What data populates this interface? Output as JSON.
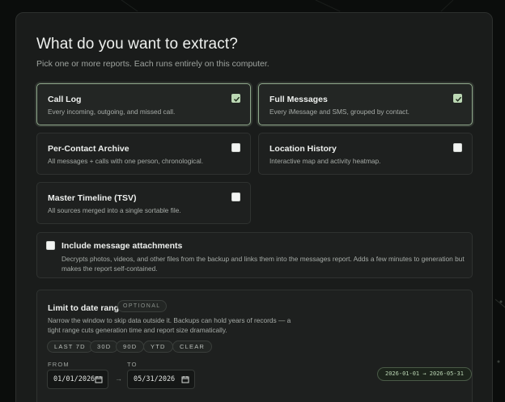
{
  "heading": "What do you want to extract?",
  "subheading": "Pick one or more reports. Each runs entirely on this computer.",
  "reports": [
    {
      "title": "Call Log",
      "description": "Every incoming, outgoing, and missed call.",
      "checked": true
    },
    {
      "title": "Full Messages",
      "description": "Every iMessage and SMS, grouped by contact.",
      "checked": true
    },
    {
      "title": "Per-Contact Archive",
      "description": "All messages + calls with one person, chronological.",
      "checked": false
    },
    {
      "title": "Location History",
      "description": "Interactive map and activity heatmap.",
      "checked": false
    },
    {
      "title": "Master Timeline (TSV)",
      "description": "All sources merged into a single sortable file.",
      "checked": false
    }
  ],
  "attachments": {
    "title": "Include message attachments",
    "description": "Decrypts photos, videos, and other files from the backup and links them into the messages report. Adds a few minutes to generation but makes the report self-contained.",
    "checked": false
  },
  "date_range": {
    "title": "Limit to date range",
    "badge": "OPTIONAL",
    "description": "Narrow the window to skip data outside it. Backups can hold years of records — a tight range cuts generation time and report size dramatically.",
    "presets": [
      "LAST 7D",
      "30D",
      "90D",
      "YTD",
      "CLEAR"
    ],
    "from_label": "FROM",
    "to_label": "TO",
    "from_value": "01/01/2026",
    "to_value": "05/31/2026",
    "separator": "→",
    "summary": "2026-01-01 → 2026-05-31"
  },
  "colors": {
    "accent": "#8fa88b",
    "checked_fill": "#bcd8b4",
    "background": "#0b0d0c",
    "panel": "#1a1c1b"
  }
}
